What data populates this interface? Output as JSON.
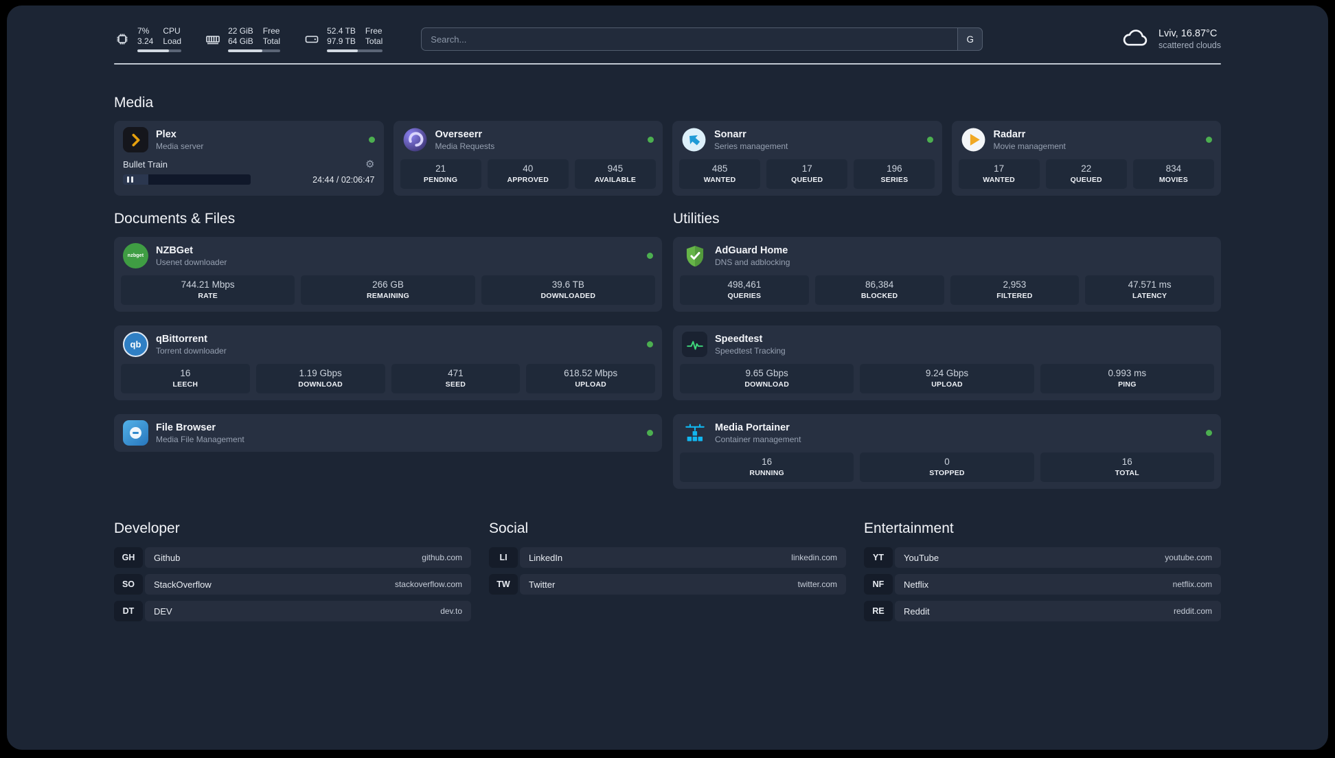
{
  "topbar": {
    "resources": [
      {
        "line1a": "7%",
        "line1b": "3.24",
        "line2a": "CPU",
        "line2b": "Load",
        "progress": 72
      },
      {
        "line1a": "22 GiB",
        "line1b": "64 GiB",
        "line2a": "Free",
        "line2b": "Total",
        "progress": 66
      },
      {
        "line1a": "52.4 TB",
        "line1b": "97.9 TB",
        "line2a": "Free",
        "line2b": "Total",
        "progress": 55
      }
    ],
    "search": {
      "placeholder": "Search...",
      "button_label": "G"
    },
    "weather": {
      "location": "Lviv, 16.87°C",
      "condition": "scattered clouds"
    }
  },
  "icons": {
    "gear_glyph": "⚙",
    "nzbget_label": "nzbget",
    "qb_label": "qb"
  },
  "colors": {
    "status_online": "#4caf50",
    "accent_green": "#3fd97c",
    "accent_blue": "#11b6ef"
  },
  "sections": {
    "media": {
      "title": "Media",
      "cards": [
        {
          "name": "Plex",
          "desc": "Media server",
          "status": "online",
          "player": {
            "track": "Bullet Train",
            "time": "24:44 / 02:06:47",
            "progress": 20
          }
        },
        {
          "name": "Overseerr",
          "desc": "Media Requests",
          "status": "online",
          "stats": [
            {
              "value": "21",
              "label": "PENDING"
            },
            {
              "value": "40",
              "label": "APPROVED"
            },
            {
              "value": "945",
              "label": "AVAILABLE"
            }
          ]
        },
        {
          "name": "Sonarr",
          "desc": "Series management",
          "status": "online",
          "stats": [
            {
              "value": "485",
              "label": "WANTED"
            },
            {
              "value": "17",
              "label": "QUEUED"
            },
            {
              "value": "196",
              "label": "SERIES"
            }
          ]
        },
        {
          "name": "Radarr",
          "desc": "Movie management",
          "status": "online",
          "stats": [
            {
              "value": "17",
              "label": "WANTED"
            },
            {
              "value": "22",
              "label": "QUEUED"
            },
            {
              "value": "834",
              "label": "MOVIES"
            }
          ]
        }
      ]
    },
    "documents": {
      "title": "Documents & Files",
      "cards": [
        {
          "name": "NZBGet",
          "desc": "Usenet downloader",
          "status": "online",
          "stats": [
            {
              "value": "744.21 Mbps",
              "label": "RATE"
            },
            {
              "value": "266 GB",
              "label": "REMAINING"
            },
            {
              "value": "39.6 TB",
              "label": "DOWNLOADED"
            }
          ]
        },
        {
          "name": "qBittorrent",
          "desc": "Torrent downloader",
          "status": "online",
          "stats": [
            {
              "value": "16",
              "label": "LEECH"
            },
            {
              "value": "1.19 Gbps",
              "label": "DOWNLOAD"
            },
            {
              "value": "471",
              "label": "SEED"
            },
            {
              "value": "618.52 Mbps",
              "label": "UPLOAD"
            }
          ]
        },
        {
          "name": "File Browser",
          "desc": "Media File Management",
          "status": "online"
        }
      ]
    },
    "utilities": {
      "title": "Utilities",
      "cards": [
        {
          "name": "AdGuard Home",
          "desc": "DNS and adblocking",
          "stats": [
            {
              "value": "498,461",
              "label": "QUERIES"
            },
            {
              "value": "86,384",
              "label": "BLOCKED"
            },
            {
              "value": "2,953",
              "label": "FILTERED"
            },
            {
              "value": "47.571 ms",
              "label": "LATENCY"
            }
          ]
        },
        {
          "name": "Speedtest",
          "desc": "Speedtest Tracking",
          "stats": [
            {
              "value": "9.65 Gbps",
              "label": "DOWNLOAD"
            },
            {
              "value": "9.24 Gbps",
              "label": "UPLOAD"
            },
            {
              "value": "0.993 ms",
              "label": "PING"
            }
          ]
        },
        {
          "name": "Media Portainer",
          "desc": "Container management",
          "status": "online",
          "stats": [
            {
              "value": "16",
              "label": "RUNNING"
            },
            {
              "value": "0",
              "label": "STOPPED"
            },
            {
              "value": "16",
              "label": "TOTAL"
            }
          ]
        }
      ]
    },
    "bookmarks": [
      {
        "title": "Developer",
        "items": [
          {
            "abbr": "GH",
            "name": "Github",
            "url": "github.com"
          },
          {
            "abbr": "SO",
            "name": "StackOverflow",
            "url": "stackoverflow.com"
          },
          {
            "abbr": "DT",
            "name": "DEV",
            "url": "dev.to"
          }
        ]
      },
      {
        "title": "Social",
        "items": [
          {
            "abbr": "LI",
            "name": "LinkedIn",
            "url": "linkedin.com"
          },
          {
            "abbr": "TW",
            "name": "Twitter",
            "url": "twitter.com"
          }
        ]
      },
      {
        "title": "Entertainment",
        "items": [
          {
            "abbr": "YT",
            "name": "YouTube",
            "url": "youtube.com"
          },
          {
            "abbr": "NF",
            "name": "Netflix",
            "url": "netflix.com"
          },
          {
            "abbr": "RE",
            "name": "Reddit",
            "url": "reddit.com"
          }
        ]
      }
    ]
  }
}
